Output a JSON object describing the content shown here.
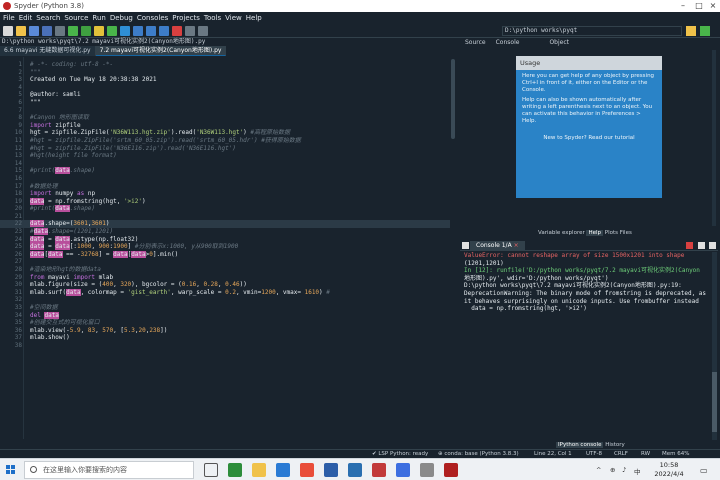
{
  "window": {
    "title": "Spyder (Python 3.8)"
  },
  "menu": [
    "File",
    "Edit",
    "Search",
    "Source",
    "Run",
    "Debug",
    "Consoles",
    "Projects",
    "Tools",
    "View",
    "Help"
  ],
  "toolbar": {
    "working_dir": "D:\\python works\\pyqt"
  },
  "editor": {
    "path": "D:\\python works\\pyqt\\7.2 mayavi可视化实例2(Canyon地形图).py",
    "tabs": [
      {
        "label": "6.6 mayavi 无缝数据可视化.py"
      },
      {
        "label": "7.2 mayavi可视化实例2(Canyon地形图).py"
      }
    ],
    "current_line": 22,
    "lines": [
      {
        "n": 1,
        "parts": [
          [
            "com",
            "# -*- coding: utf-8 -*-"
          ]
        ]
      },
      {
        "n": 2,
        "parts": [
          [
            "com",
            "\"\"\""
          ]
        ]
      },
      {
        "n": 3,
        "parts": [
          [
            "txt",
            "Created on Tue May 18 20:38:38 2021"
          ]
        ]
      },
      {
        "n": 4,
        "parts": [
          [
            "txt",
            ""
          ]
        ]
      },
      {
        "n": 5,
        "parts": [
          [
            "txt",
            "@author: samli"
          ]
        ]
      },
      {
        "n": 6,
        "parts": [
          [
            "txt",
            "\"\"\""
          ]
        ]
      },
      {
        "n": 7,
        "parts": [
          [
            "txt",
            ""
          ]
        ]
      },
      {
        "n": 8,
        "parts": [
          [
            "com",
            "#Canyon 地形图读取"
          ]
        ]
      },
      {
        "n": 9,
        "parts": [
          [
            "kw",
            "import"
          ],
          [
            "txt",
            " zipfile"
          ]
        ]
      },
      {
        "n": 10,
        "parts": [
          [
            "txt",
            "hgt = zipfile.ZipFile("
          ],
          [
            "str",
            "'N36W113.hgt.zip'"
          ],
          [
            "txt",
            ").read("
          ],
          [
            "str",
            "'N36W113.hgt'"
          ],
          [
            "txt",
            ") "
          ],
          [
            "com",
            "#高程原始数据"
          ]
        ]
      },
      {
        "n": 11,
        "parts": [
          [
            "com",
            "#hgt = zipfile.ZipFile('srtm_60_05.zip').read('srtm_60_05.hdr') #获得原始数据"
          ]
        ]
      },
      {
        "n": 12,
        "parts": [
          [
            "com",
            "#hgt = zipfile.ZipFile('N36E116.zip').read('N36E116.hgt')"
          ]
        ]
      },
      {
        "n": 13,
        "parts": [
          [
            "com",
            "#hgt(height file format)"
          ]
        ]
      },
      {
        "n": 14,
        "parts": [
          [
            "txt",
            ""
          ]
        ]
      },
      {
        "n": 15,
        "parts": [
          [
            "com",
            "#print("
          ],
          [
            "pink",
            "data"
          ],
          [
            "com",
            ".shape)"
          ]
        ]
      },
      {
        "n": 16,
        "parts": [
          [
            "txt",
            ""
          ]
        ]
      },
      {
        "n": 17,
        "parts": [
          [
            "com",
            "#数据处理"
          ]
        ]
      },
      {
        "n": 18,
        "parts": [
          [
            "kw",
            "import"
          ],
          [
            "txt",
            " numpy "
          ],
          [
            "kw",
            "as"
          ],
          [
            "txt",
            " np"
          ]
        ]
      },
      {
        "n": 19,
        "parts": [
          [
            "pink",
            "data"
          ],
          [
            "txt",
            " = np.fromstring(hgt, "
          ],
          [
            "str",
            "'>i2'"
          ],
          [
            "txt",
            ")"
          ]
        ]
      },
      {
        "n": 20,
        "parts": [
          [
            "com",
            "#print("
          ],
          [
            "pink",
            "data"
          ],
          [
            "com",
            ".shape)"
          ]
        ]
      },
      {
        "n": 21,
        "parts": [
          [
            "txt",
            ""
          ]
        ]
      },
      {
        "n": 22,
        "parts": [
          [
            "pink",
            "data"
          ],
          [
            "txt",
            ".shape=("
          ],
          [
            "num",
            "3601"
          ],
          [
            "txt",
            ","
          ],
          [
            "num",
            "3601"
          ],
          [
            "txt",
            ")"
          ]
        ]
      },
      {
        "n": 23,
        "parts": [
          [
            "com",
            "#"
          ],
          [
            "pink",
            "data"
          ],
          [
            "com",
            ".shape=(1201,1201)"
          ]
        ]
      },
      {
        "n": 24,
        "parts": [
          [
            "pink",
            "data"
          ],
          [
            "txt",
            " = "
          ],
          [
            "pink",
            "data"
          ],
          [
            "txt",
            ".astype(np.float32)"
          ]
        ]
      },
      {
        "n": 25,
        "parts": [
          [
            "pink",
            "data"
          ],
          [
            "txt",
            " = "
          ],
          [
            "pink",
            "data"
          ],
          [
            "txt",
            "[:"
          ],
          [
            "num",
            "1000"
          ],
          [
            "txt",
            ", "
          ],
          [
            "num",
            "900"
          ],
          [
            "txt",
            ":"
          ],
          [
            "num",
            "1900"
          ],
          [
            "txt",
            "] "
          ],
          [
            "com",
            "#分别表示x:1000, y从900取到1900"
          ]
        ]
      },
      {
        "n": 26,
        "parts": [
          [
            "pink",
            "data"
          ],
          [
            "txt",
            "["
          ],
          [
            "pink",
            "data"
          ],
          [
            "txt",
            " == -"
          ],
          [
            "num",
            "32768"
          ],
          [
            "txt",
            "] = "
          ],
          [
            "pink",
            "data"
          ],
          [
            "txt",
            "["
          ],
          [
            "pink",
            "data"
          ],
          [
            "txt",
            ">"
          ],
          [
            "num",
            "0"
          ],
          [
            "txt",
            "].min()"
          ]
        ]
      },
      {
        "n": 27,
        "parts": [
          [
            "txt",
            ""
          ]
        ]
      },
      {
        "n": 28,
        "parts": [
          [
            "com",
            "#渲染地形hgt的数据data"
          ]
        ]
      },
      {
        "n": 29,
        "parts": [
          [
            "kw",
            "from"
          ],
          [
            "txt",
            " mayavi "
          ],
          [
            "kw",
            "import"
          ],
          [
            "txt",
            " mlab"
          ]
        ]
      },
      {
        "n": 30,
        "parts": [
          [
            "txt",
            "mlab.figure(size = ("
          ],
          [
            "num",
            "400"
          ],
          [
            "txt",
            ", "
          ],
          [
            "num",
            "320"
          ],
          [
            "txt",
            "), bgcolor = ("
          ],
          [
            "num",
            "0.16"
          ],
          [
            "txt",
            ", "
          ],
          [
            "num",
            "0.28"
          ],
          [
            "txt",
            ", "
          ],
          [
            "num",
            "0.46"
          ],
          [
            "txt",
            "))"
          ]
        ]
      },
      {
        "n": 31,
        "parts": [
          [
            "txt",
            "mlab.surf("
          ],
          [
            "pink",
            "data"
          ],
          [
            "txt",
            ", colormap = "
          ],
          [
            "str",
            "'gist_earth'"
          ],
          [
            "txt",
            ", warp_scale = "
          ],
          [
            "num",
            "0.2"
          ],
          [
            "txt",
            ", vmin="
          ],
          [
            "num",
            "1200"
          ],
          [
            "txt",
            ", vmax= "
          ],
          [
            "num",
            "1610"
          ],
          [
            "txt",
            ") "
          ],
          [
            "com",
            "#"
          ]
        ]
      },
      {
        "n": 32,
        "parts": [
          [
            "txt",
            ""
          ]
        ]
      },
      {
        "n": 33,
        "parts": [
          [
            "com",
            "#空间数据"
          ]
        ]
      },
      {
        "n": 34,
        "parts": [
          [
            "kw",
            "del"
          ],
          [
            "txt",
            " "
          ],
          [
            "pink",
            "data"
          ]
        ]
      },
      {
        "n": 35,
        "parts": [
          [
            "com",
            "#创建交互式的可视化窗口"
          ]
        ]
      },
      {
        "n": 36,
        "parts": [
          [
            "txt",
            "mlab.view(-"
          ],
          [
            "num",
            "5.9"
          ],
          [
            "txt",
            ", "
          ],
          [
            "num",
            "83"
          ],
          [
            "txt",
            ", "
          ],
          [
            "num",
            "570"
          ],
          [
            "txt",
            ", ["
          ],
          [
            "num",
            "5.3"
          ],
          [
            "txt",
            ","
          ],
          [
            "num",
            "20"
          ],
          [
            "txt",
            ","
          ],
          [
            "num",
            "238"
          ],
          [
            "txt",
            "])"
          ]
        ]
      },
      {
        "n": 37,
        "parts": [
          [
            "txt",
            "mlab.show()"
          ]
        ]
      },
      {
        "n": 38,
        "parts": [
          [
            "txt",
            ""
          ]
        ]
      }
    ]
  },
  "help_pane": {
    "tabs": [
      "Source",
      "Console",
      "Object"
    ],
    "usage_title": "Usage",
    "p1": "Here you can get help of any object by pressing Ctrl+I in front of it, either on the Editor or the Console.",
    "p2": "Help can also be shown automatically after writing a left parenthesis next to an object. You can activate this behavior in Preferences > Help.",
    "p3": "New to Spyder? Read our tutorial"
  },
  "mid_tabs": [
    "Variable explorer",
    "Help",
    "Plots",
    "Files"
  ],
  "console": {
    "tab_label": "Console 1/A",
    "lines": [
      {
        "cls": "err",
        "text": "ValueError: cannot reshape array of size 1500x1201 into shape"
      },
      {
        "cls": "txt",
        "text": "(1201,1201)"
      },
      {
        "cls": "txt",
        "text": ""
      },
      {
        "cls": "prompt",
        "text": "In [12]: runfile('D:/python works/pyqt/7.2 mayavi可视化实例2(Canyon"
      },
      {
        "cls": "txt",
        "text": "地形图).py', wdir='D:/python works/pyqt')"
      },
      {
        "cls": "txt",
        "text": "D:\\python works\\pyqt\\7.2 mayavi可视化实例2(Canyon地形图).py:19:"
      },
      {
        "cls": "txt",
        "text": "DeprecationWarning: The binary mode of fromstring is deprecated, as"
      },
      {
        "cls": "txt",
        "text": "it behaves surprisingly on unicode inputs. Use frombuffer instead"
      },
      {
        "cls": "txt",
        "text": "  data = np.fromstring(hgt, '>i2')"
      }
    ]
  },
  "bottom_tabs": [
    "IPython console",
    "History"
  ],
  "status": {
    "lsp": "✔ LSP Python: ready",
    "conda": "⊕ conda: base (Python 3.8.3)",
    "pos": "Line 22, Col 1",
    "enc": "UTF-8",
    "eol": "CRLF",
    "rw": "RW",
    "mem": "Mem 64%"
  },
  "taskbar": {
    "search_placeholder": "在这里输入你要搜索的内容",
    "time": "10:58",
    "date": "2022/4/4",
    "ime": "中",
    "colors": {
      "accent": "#1e6fc8"
    }
  }
}
